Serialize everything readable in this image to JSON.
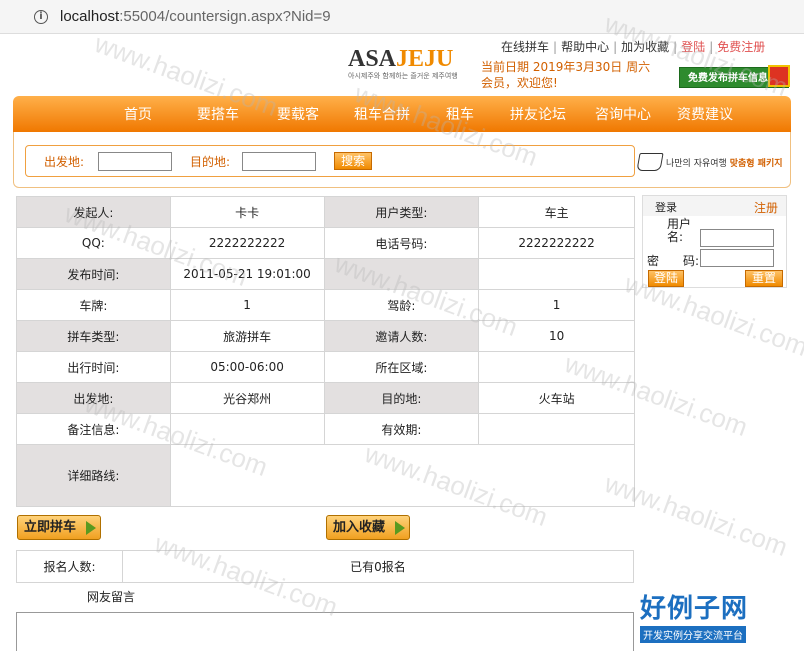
{
  "browser": {
    "url_host": "localhost",
    "url_rest": ":55004/countersign.aspx?Nid=9"
  },
  "logo": {
    "part1": "ASA",
    "part2": "JEJU",
    "tagline": "아시제주와 함께하는 즐거운 제주여행"
  },
  "toplinks": [
    "在线拼车",
    "帮助中心",
    "加为收藏",
    "登陆",
    "免费注册"
  ],
  "date_text": "当前日期  2019年3月30日  周六",
  "welcome_text": "会员，欢迎您!",
  "publish_button": "免费发布拼车信息",
  "nav": [
    "首页",
    "要搭车",
    "要载客",
    "租车合拼",
    "租车",
    "拼友论坛",
    "咨询中心",
    "资费建议"
  ],
  "search": {
    "from_label": "出发地:",
    "to_label": "目的地:",
    "button": "搜索"
  },
  "banner": {
    "text1": "나만의 자유여행",
    "text2": "맞춤형 패키지"
  },
  "detail": {
    "rows": [
      [
        "发起人:",
        "卡卡",
        "用户类型:",
        "车主"
      ],
      [
        "QQ:",
        "2222222222",
        "电话号码:",
        "2222222222"
      ],
      [
        "发布时间:",
        "2011-05-21 19:01:00",
        "",
        ""
      ],
      [
        "车牌:",
        "1",
        "驾龄:",
        "1"
      ],
      [
        "拼车类型:",
        "旅游拼车",
        "邀请人数:",
        "10"
      ],
      [
        "出行时间:",
        "05:00-06:00",
        "所在区域:",
        ""
      ],
      [
        "出发地:",
        "光谷郑州",
        "目的地:",
        "火车站"
      ],
      [
        "备注信息:",
        "",
        "有效期:",
        ""
      ]
    ],
    "route_label": "详细路线:",
    "route_value": ""
  },
  "login": {
    "title": "登录",
    "register": "注册",
    "user_label": "用户名:",
    "pwd_label_1": "密",
    "pwd_label_2": "码:",
    "login_btn": "登陆",
    "reset_btn": "重置"
  },
  "actions": {
    "join": "立即拼车",
    "favorite": "加入收藏"
  },
  "signup": {
    "count_label": "报名人数:",
    "count_value": "已有0报名",
    "message_label": "网友留言"
  },
  "brand": {
    "main": "好例子网",
    "sub": "开发实例分享交流平台"
  },
  "watermark": "www.haolizi.com",
  "colors": {
    "accent": "#f07800",
    "text_orange": "#d26000",
    "brand_blue": "#1c6fc0"
  }
}
